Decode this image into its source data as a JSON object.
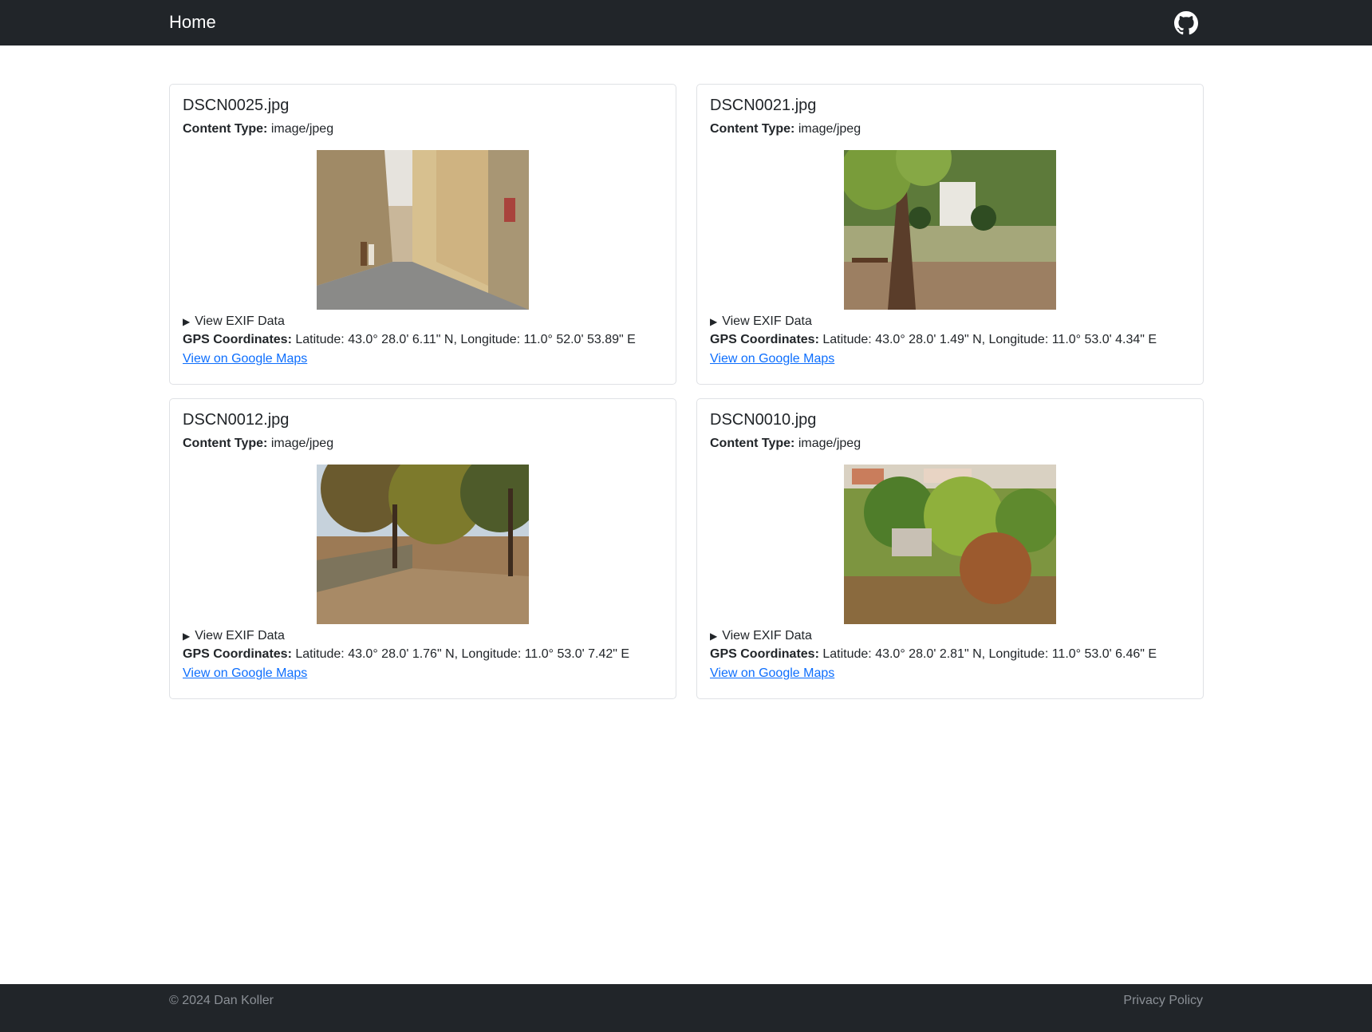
{
  "navbar": {
    "brand": "Home",
    "github_icon": "github-icon"
  },
  "photos": [
    {
      "filename": "DSCN0025.jpg",
      "content_type_label": "Content Type:",
      "content_type": "image/jpeg",
      "exif_label": "View EXIF Data",
      "gps_label": "GPS Coordinates:",
      "gps": "Latitude: 43.0° 28.0' 6.11\" N, Longitude: 11.0° 52.0' 53.89\" E",
      "maps_link": "View on Google Maps"
    },
    {
      "filename": "DSCN0021.jpg",
      "content_type_label": "Content Type:",
      "content_type": "image/jpeg",
      "exif_label": "View EXIF Data",
      "gps_label": "GPS Coordinates:",
      "gps": "Latitude: 43.0° 28.0' 1.49\" N, Longitude: 11.0° 53.0' 4.34\" E",
      "maps_link": "View on Google Maps"
    },
    {
      "filename": "DSCN0012.jpg",
      "content_type_label": "Content Type:",
      "content_type": "image/jpeg",
      "exif_label": "View EXIF Data",
      "gps_label": "GPS Coordinates:",
      "gps": "Latitude: 43.0° 28.0' 1.76\" N, Longitude: 11.0° 53.0' 7.42\" E",
      "maps_link": "View on Google Maps"
    },
    {
      "filename": "DSCN0010.jpg",
      "content_type_label": "Content Type:",
      "content_type": "image/jpeg",
      "exif_label": "View EXIF Data",
      "gps_label": "GPS Coordinates:",
      "gps": "Latitude: 43.0° 28.0' 2.81\" N, Longitude: 11.0° 53.0' 6.46\" E",
      "maps_link": "View on Google Maps"
    }
  ],
  "footer": {
    "copyright": "© 2024 Dan Koller",
    "privacy": "Privacy Policy"
  },
  "colors": {
    "navbar_bg": "#212529",
    "link": "#0d6efd",
    "footer_text": "#8b9096"
  }
}
